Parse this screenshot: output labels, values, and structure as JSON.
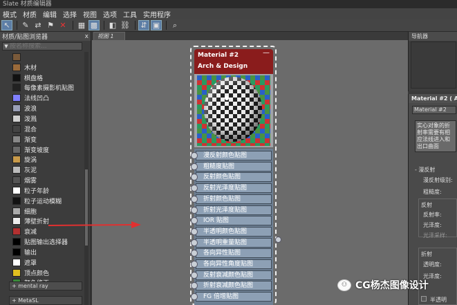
{
  "title": "Slate 材质编辑器",
  "menu": [
    "模式",
    "材质",
    "编辑",
    "选择",
    "视图",
    "选项",
    "工具",
    "实用程序"
  ],
  "browser": {
    "title": "材质/贴图浏览器",
    "close": "x",
    "search_placeholder": "按名称搜索...",
    "items": [
      {
        "label": "",
        "color": "#7a5a3a"
      },
      {
        "label": "木材",
        "color": "#9a6a3a"
      },
      {
        "label": "棋盘格",
        "color": "#111111"
      },
      {
        "label": "每像素摄影机贴图",
        "color": "#222222"
      },
      {
        "label": "法线凹凸",
        "color": "#8080ff"
      },
      {
        "label": "波浪",
        "color": "#9aa0b8"
      },
      {
        "label": "泼溅",
        "color": "#d0d0d0"
      },
      {
        "label": "混合",
        "color": "#444444"
      },
      {
        "label": "渐变",
        "color": "#888888"
      },
      {
        "label": "渐变坡度",
        "color": "#6a6a6a"
      },
      {
        "label": "旋涡",
        "color": "#c89a4a"
      },
      {
        "label": "灰泥",
        "color": "#bbbbbb"
      },
      {
        "label": "烟雾",
        "color": "#555555"
      },
      {
        "label": "粒子年龄",
        "color": "#ffffff"
      },
      {
        "label": "粒子运动模糊",
        "color": "#111111"
      },
      {
        "label": "细胞",
        "color": "#aaaaaa"
      },
      {
        "label": "薄壁折射",
        "color": "#eeeeee"
      },
      {
        "label": "衰减",
        "color": "#b23030"
      },
      {
        "label": "贴图输出选择器",
        "color": "#000000"
      },
      {
        "label": "输出",
        "color": "#000000"
      },
      {
        "label": "遮罩",
        "color": "#ffffff"
      },
      {
        "label": "顶点颜色",
        "color": "#e0c020"
      },
      {
        "label": "颜色修正",
        "color": "#3a8a3a"
      }
    ],
    "rollouts": [
      "+ mental ray",
      "+ MetaSL"
    ]
  },
  "view_tab": "视图 1",
  "node": {
    "title": "Material #2",
    "subtitle": "Arch & Design",
    "collapse": "—",
    "slots": [
      "漫反射颜色贴图",
      "粗糙度贴图",
      "反射颜色贴图",
      "反射光泽度贴图",
      "折射颜色贴图",
      "折射光泽度贴图",
      "IOR 贴图",
      "半透明颜色贴图",
      "半透明重量贴图",
      "各向异性贴图",
      "各向异性角度贴图",
      "反射衰减颜色贴图",
      "折射衰减颜色贴图",
      "FG 倍增贴图"
    ]
  },
  "navigator": {
    "title": "导航器"
  },
  "props": {
    "header": "Material #2  ( Ar",
    "name": "Material #2",
    "description": "实心对象的折射率需要有相应法线进入和出口曲面",
    "sec1": "- 漫反射",
    "f1": "漫反射级别:",
    "f2": "粗糙度:",
    "sec2": "反射",
    "f3": "反射率:",
    "f4": "光泽度:",
    "f5": "光泽采样:",
    "sec3": "折射",
    "f6": "透明度:",
    "f7": "光泽度:",
    "f8": "半透明"
  },
  "watermark": "CG杨杰图像设计"
}
